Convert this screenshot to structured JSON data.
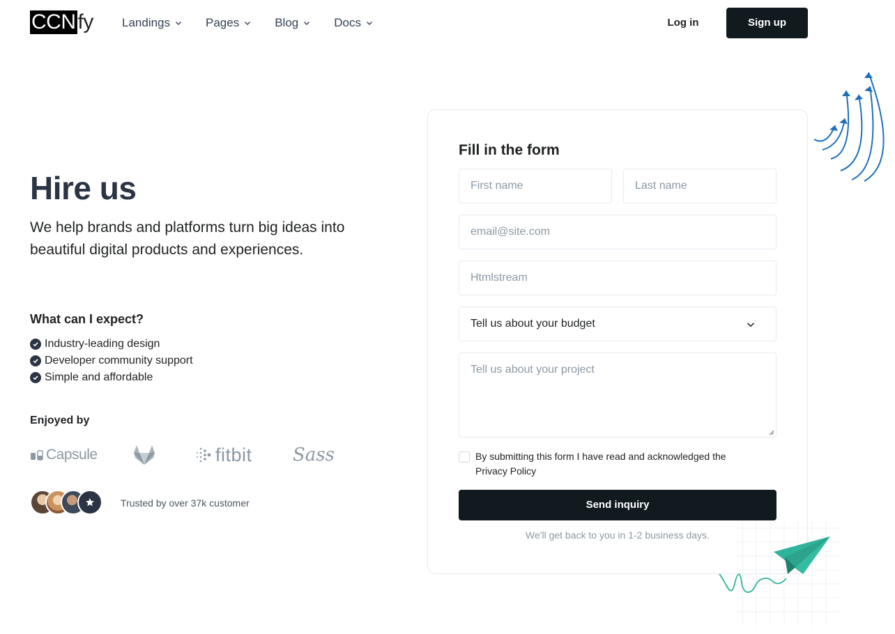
{
  "nav": {
    "logo_box": "CCN",
    "logo_rest": "fy",
    "menu": [
      {
        "label": "Landings"
      },
      {
        "label": "Pages"
      },
      {
        "label": "Blog"
      },
      {
        "label": "Docs"
      }
    ],
    "login_label": "Log in",
    "signup_label": "Sign up"
  },
  "hero": {
    "title": "Hire us",
    "subtitle": "We help brands and platforms turn big ideas into beautiful digital products and experiences.",
    "expect_title": "What can I expect?",
    "checks": [
      "Industry-leading design",
      "Developer community support",
      "Simple and affordable"
    ],
    "enjoyed_by": "Enjoyed by",
    "brands": {
      "capsule": "Capsule",
      "fitbit": "fitbit",
      "sass": "Sass"
    },
    "trusted_text": "Trusted by over 37k customer"
  },
  "form": {
    "title": "Fill in the form",
    "first_name_placeholder": "First name",
    "last_name_placeholder": "Last name",
    "email_placeholder": "email@site.com",
    "company_placeholder": "Htmlstream",
    "budget_selected": "Tell us about your budget",
    "project_placeholder": "Tell us about your project",
    "consent_text": "By submitting this form I have read and acknowledged the",
    "consent_link": "Privacy Policy",
    "submit_label": "Send inquiry",
    "note": "We'll get back to you in 1-2 business days."
  },
  "colors": {
    "primary_dark": "#111a1f",
    "text": "#1e2022",
    "muted": "#8c98a4",
    "border": "#e7eaf3",
    "arrow_blue": "#1e6fb8",
    "plane_teal": "#2fb39a"
  }
}
